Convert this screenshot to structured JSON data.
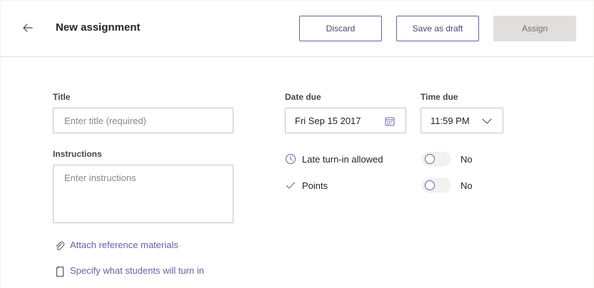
{
  "header": {
    "title": "New assignment",
    "discard_label": "Discard",
    "save_draft_label": "Save as draft",
    "assign_label": "Assign"
  },
  "form": {
    "title_label": "Title",
    "title_placeholder": "Enter title (required)",
    "instructions_label": "Instructions",
    "instructions_placeholder": "Enter instructions",
    "date_due_label": "Date due",
    "date_due_value": "Fri Sep 15 2017",
    "time_due_label": "Time due",
    "time_due_value": "11:59 PM",
    "late_turnin_label": "Late turn-in allowed",
    "late_turnin_state": "No",
    "points_label": "Points",
    "points_state": "No",
    "attach_link": "Attach reference materials",
    "specify_link": "Specify what students will turn in"
  },
  "icons": {
    "back": "back-arrow-icon",
    "calendar": "calendar-icon",
    "chevron": "chevron-down-icon",
    "clock": "clock-icon",
    "check": "checkmark-icon",
    "paperclip": "paperclip-icon",
    "document": "document-icon"
  },
  "colors": {
    "accent": "#6264a7",
    "disabled_bg": "#e1dfdd"
  }
}
